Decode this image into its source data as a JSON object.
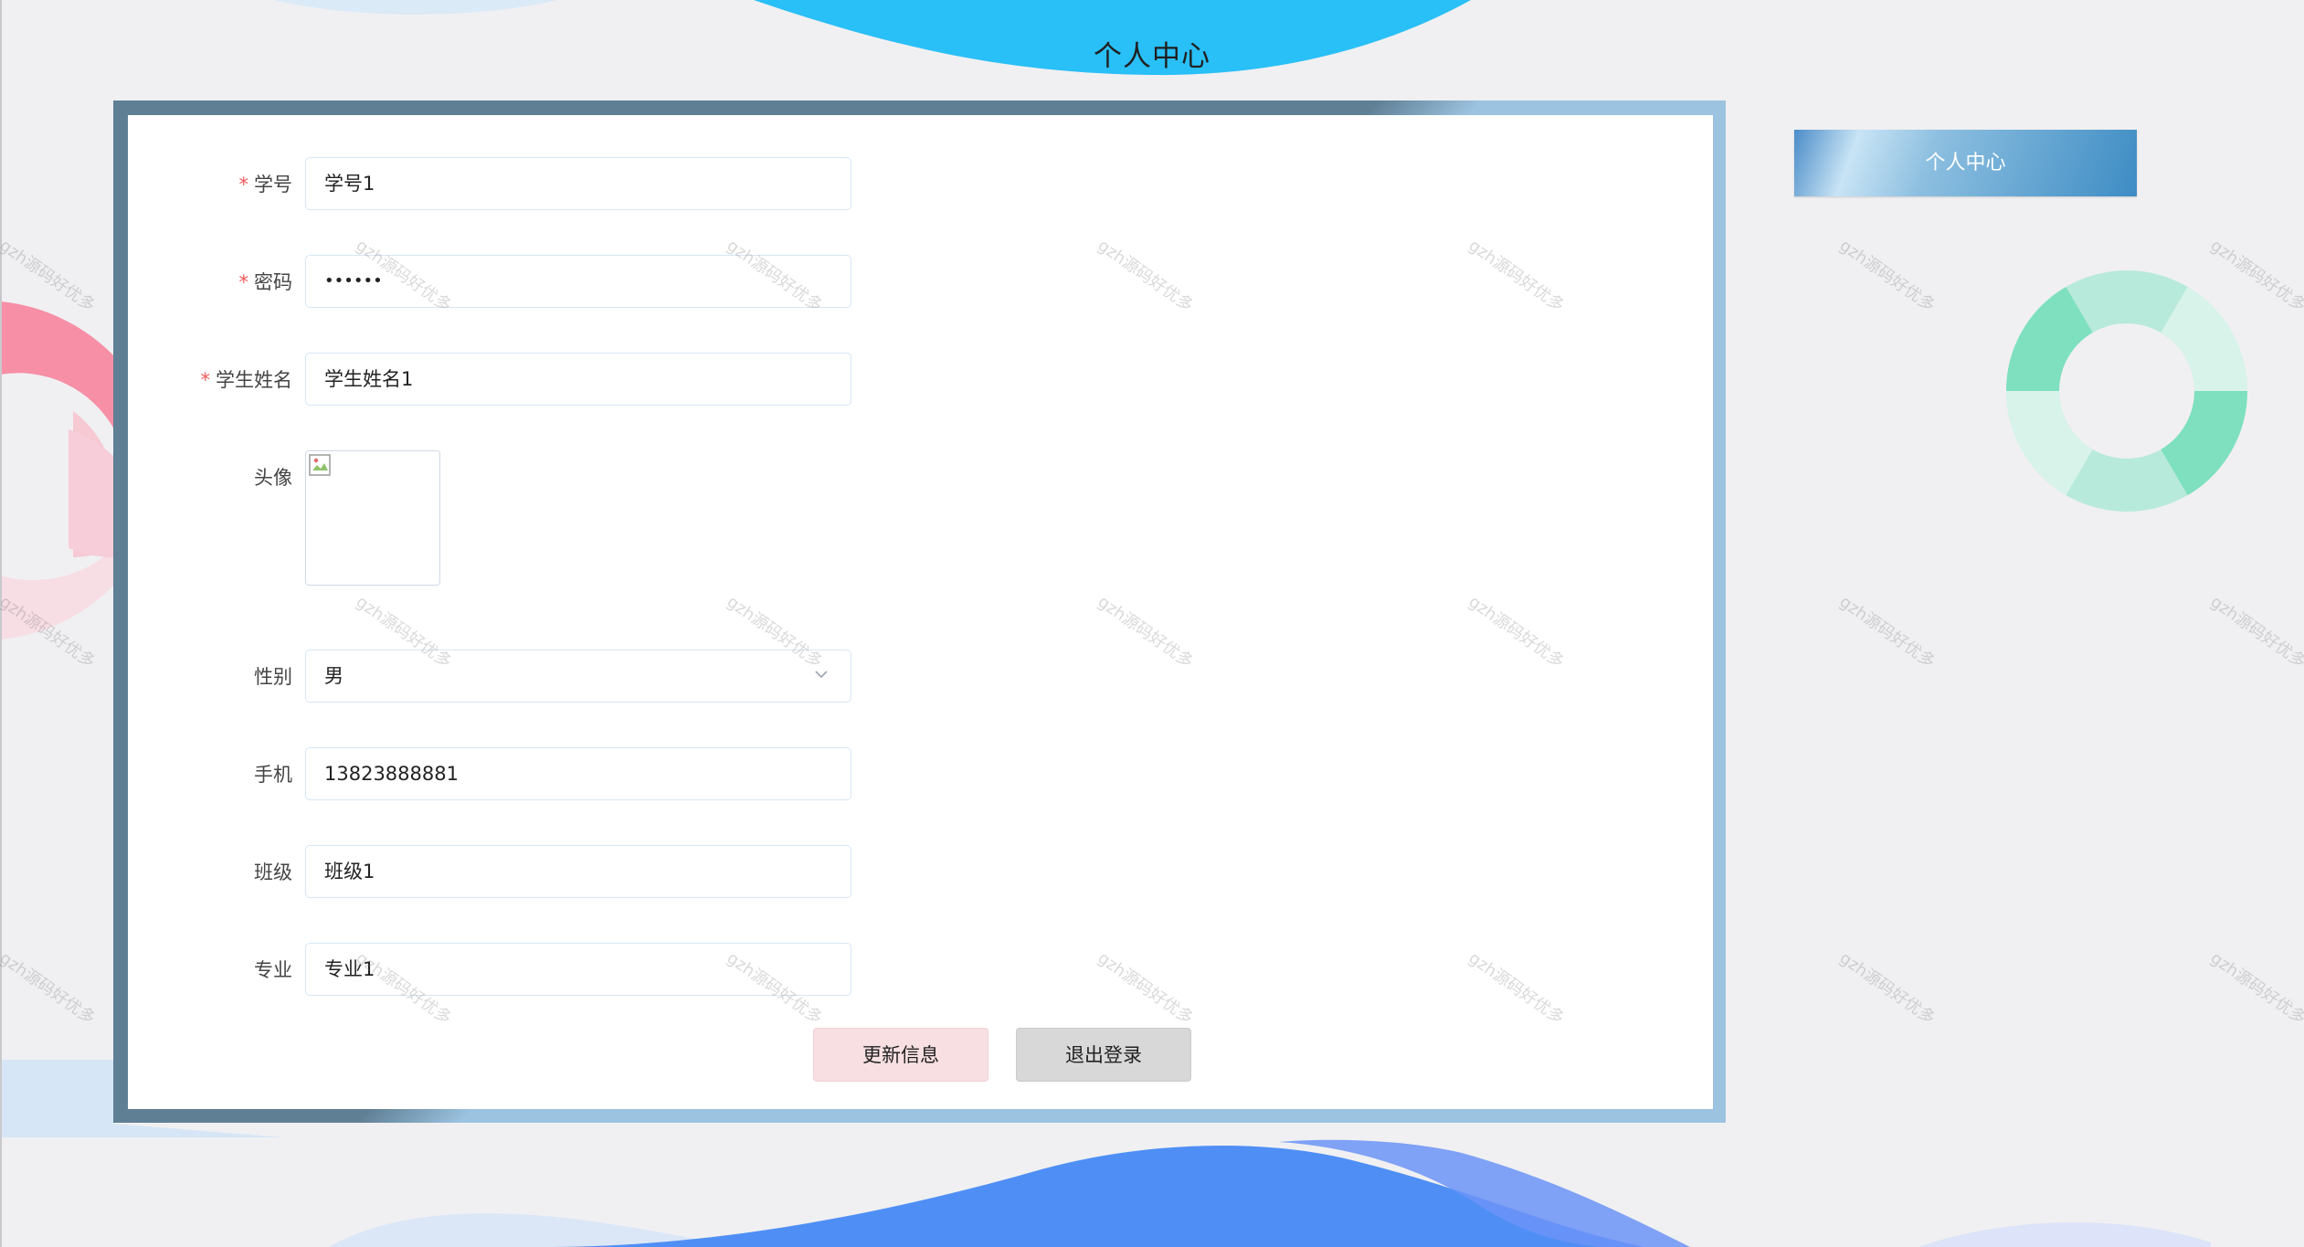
{
  "page": {
    "title": "个人中心"
  },
  "form": {
    "fields": [
      {
        "label": "学号",
        "required": true,
        "value": "学号1"
      },
      {
        "label": "密码",
        "required": true,
        "value": "••••••"
      },
      {
        "label": "学生姓名",
        "required": true,
        "value": "学生姓名1"
      },
      {
        "label": "头像",
        "required": false
      },
      {
        "label": "性别",
        "required": false,
        "value": "男"
      },
      {
        "label": "手机",
        "required": false,
        "value": "13823888881"
      },
      {
        "label": "班级",
        "required": false,
        "value": "班级1"
      },
      {
        "label": "专业",
        "required": false,
        "value": "专业1"
      }
    ],
    "update_label": "更新信息",
    "logout_label": "退出登录"
  },
  "sidebar": {
    "button_label": "个人中心"
  },
  "watermark": {
    "text": "gzh源码好优多"
  },
  "colors": {
    "required_star": "#f25a5a",
    "update_button": "#f7dfe2",
    "logout_button": "#d8d8d8",
    "frame_dark": "#5f7f95",
    "frame_light": "#9cc3e0",
    "donut_green": "#7ee0be",
    "pink_ring": "#f78fa7"
  },
  "icons": {
    "avatar": "broken-image-icon",
    "select": "chevron-down-icon"
  }
}
